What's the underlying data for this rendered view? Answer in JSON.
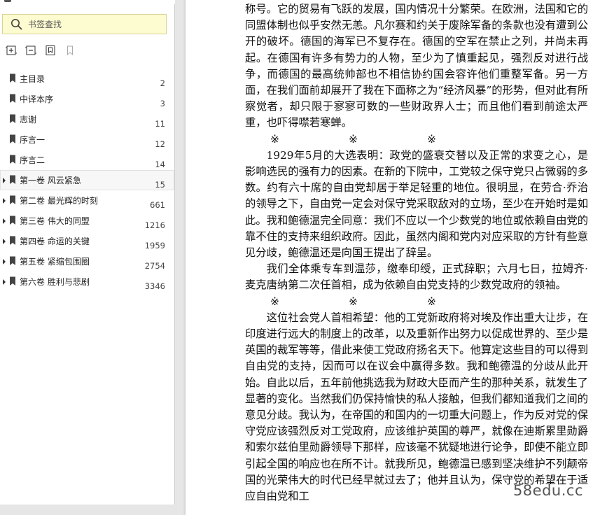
{
  "sidebar": {
    "search": {
      "placeholder": "书签查找"
    },
    "toolbar": [
      {
        "icon": "expand-all-icon"
      },
      {
        "icon": "collapse-all-icon"
      },
      {
        "icon": "add-bookmark-icon"
      },
      {
        "icon": "delete-bookmark-icon"
      }
    ],
    "bookmarks": [
      {
        "label": "主目录",
        "page": "2",
        "expandable": false
      },
      {
        "label": "中译本序",
        "page": "3",
        "expandable": false
      },
      {
        "label": "志谢",
        "page": "11",
        "expandable": false
      },
      {
        "label": "序言一",
        "page": "12",
        "expandable": false
      },
      {
        "label": "序言二",
        "page": "14",
        "expandable": false
      },
      {
        "label": "第一卷  风云紧急",
        "page": "15",
        "expandable": true,
        "selected": true
      },
      {
        "label": "第二卷  最光辉的时刻",
        "page": "661",
        "expandable": true
      },
      {
        "label": "第三卷  伟大的同盟",
        "page": "1216",
        "expandable": true
      },
      {
        "label": "第四卷  命运的关键",
        "page": "1959",
        "expandable": true
      },
      {
        "label": "第五卷  紧缩包围圈",
        "page": "2754",
        "expandable": true
      },
      {
        "label": "第六卷  胜利与悲剧",
        "page": "3346",
        "expandable": true
      }
    ]
  },
  "document": {
    "para1": "称号。它的贸易有飞跃的发展，国内情况十分繁荣。在欧洲，法国和它的同盟体制也似乎安然无恙。凡尔赛和约关于废除军备的条款也没有遭到公开的破坏。德国的海军已不复存在。德国的空军在禁止之列，并尚未再起。在德国有许多有势力的人物，至少为了慎重起见，强烈反对进行战争，而德国的最高统帅部也不相信协约国会容许他们重整军备。另一方面，在我们面前却展开了我在下面称之为“经济风暴”的形势，但对此有所察觉者，却只限于寥寥可数的一些财政界人士；而且他们看到前途太严重，也吓得噤若寒蝉。",
    "separator": "※",
    "para2": "1929年5月的大选表明：政党的盛衰交替以及正常的求变之心，是影响选民的强有力的因素。在新的下院中，工党较之保守党只占微弱的多数。约有六十席的自由党却居于举足轻重的地位。很明显，在劳合·乔治的领导之下，自由党一定会对保守党采取敌对的立场，至少在开始时是如此。我和鲍德温完全同意：我们不应以一个少数党的地位或依赖自由党的靠不住的支持来组织政府。因此，虽然内阁和党内对应采取的方针有些意见分歧，鲍德温还是向国王提出了辞呈。",
    "para3": "我们全体乘专车到温莎，缴奉印绶，正式辞职；六月七日，拉姆齐·麦克唐纳第二次任首相，成为依赖自由党支持的少数党政府的领袖。",
    "para4": "这位社会党人首相希望：他的工党新政府将对埃及作出重大让步，在印度进行远大的制度上的改革，以及重新作出努力以促成世界的、至少是英国的裁军等等，借此来使工党政府扬名天下。他算定这些目的可以得到自由党的支持，因而可以在议会中赢得多数。我和鲍德温的分歧从此开始。自此以后，五年前他挑选我为财政大臣而产生的那种关系，就发生了显著的变化。当然我们仍保持愉快的私人接触，但我们都知道我们之间的意见分歧。我认为，在帝国的和国内的一切重大问题上，作为反对党的保守党应该强烈反对工党政府，应该维护英国的尊严，就像在迪斯累里勋爵和索尔兹伯里勋爵领导下那样，应该毫不犹疑地进行论争，即使不能立即引起全国的响应也在所不计。就我所见，鲍德温已感到坚决维护不列颠帝国的光荣伟大的时代已经早就过去了；他并且认为，保守党的希望在于适应自由党和工"
  },
  "watermark": "58edu.cc"
}
